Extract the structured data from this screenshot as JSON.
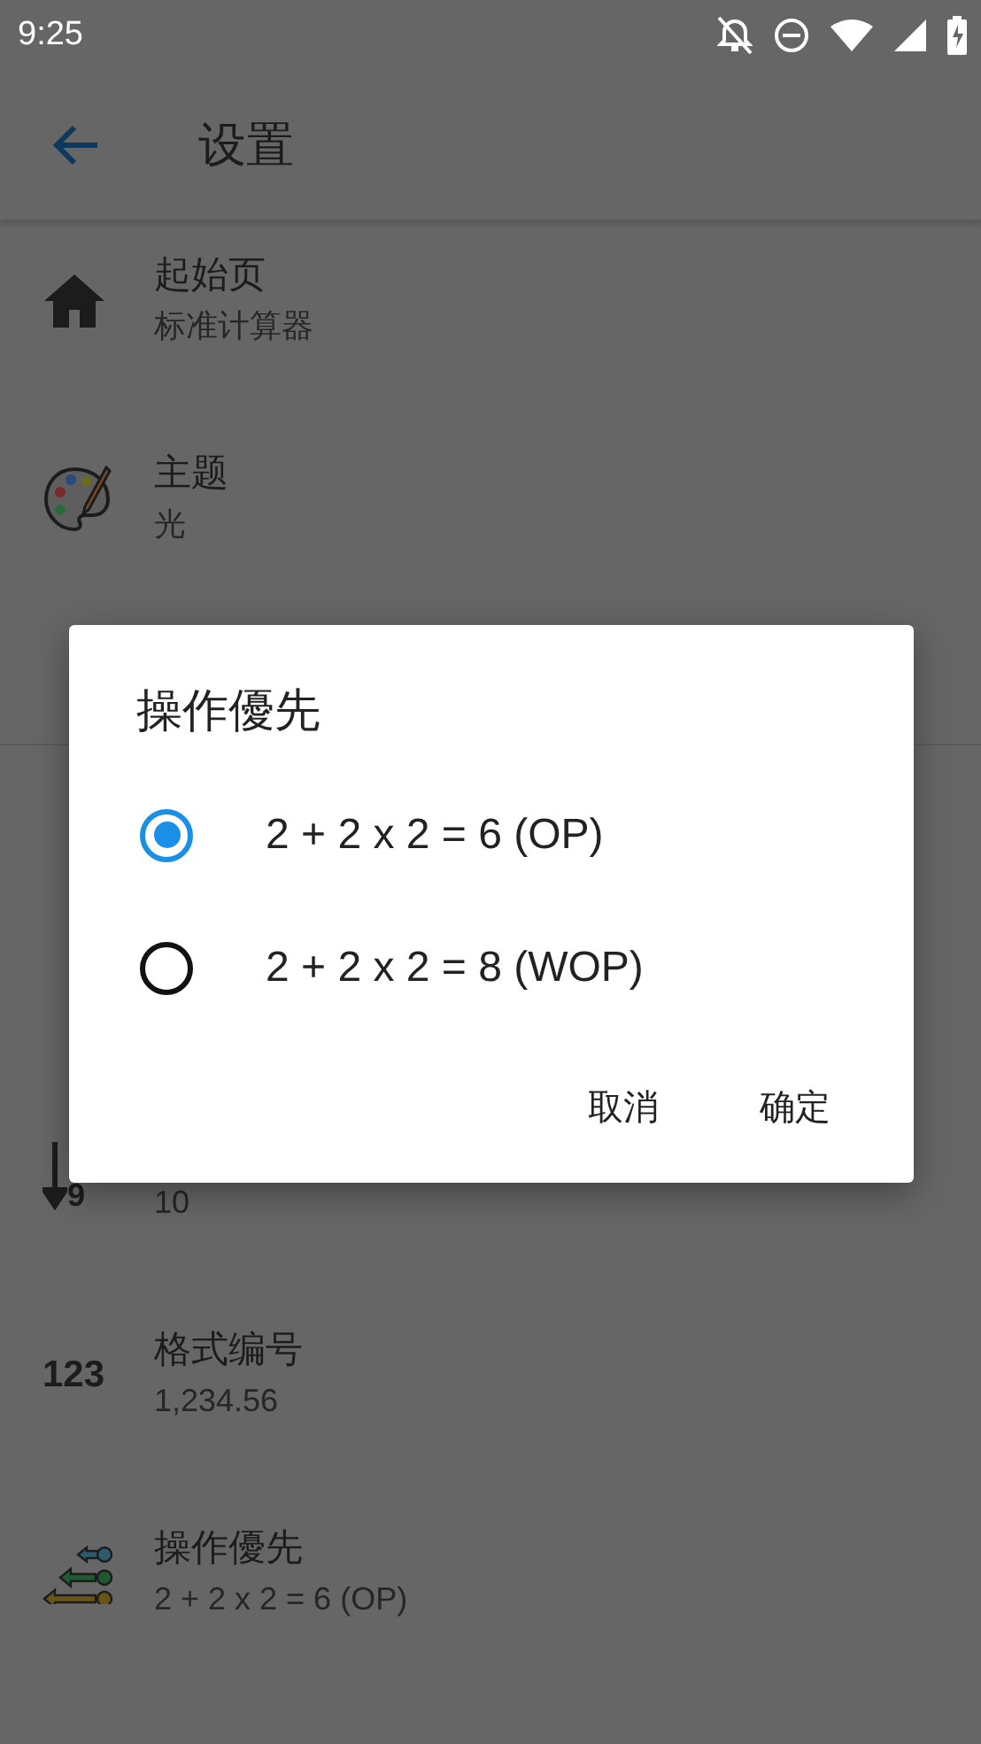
{
  "status_bar": {
    "time": "9:25"
  },
  "app_bar": {
    "title": "设置"
  },
  "settings_top": [
    {
      "kind": "home",
      "title": "起始页",
      "summary": "标准计算器"
    },
    {
      "kind": "palette",
      "title": "主题",
      "summary": "光"
    }
  ],
  "settings_bottom": [
    {
      "kind": "sort",
      "icon_text": "9",
      "summary": "10"
    },
    {
      "kind": "digits",
      "icon_text": "123",
      "title": "格式编号",
      "summary": "1,234.56"
    },
    {
      "kind": "priority",
      "title": "操作優先",
      "summary": "2 + 2 x 2 = 6 (OP)"
    }
  ],
  "dialog": {
    "title": "操作優先",
    "options": [
      {
        "label": "2 + 2 x 2 = 6 (OP)",
        "selected": true
      },
      {
        "label": "2 + 2 x 2 = 8 (WOP)",
        "selected": false
      }
    ],
    "buttons": [
      "取消",
      "确定"
    ]
  }
}
